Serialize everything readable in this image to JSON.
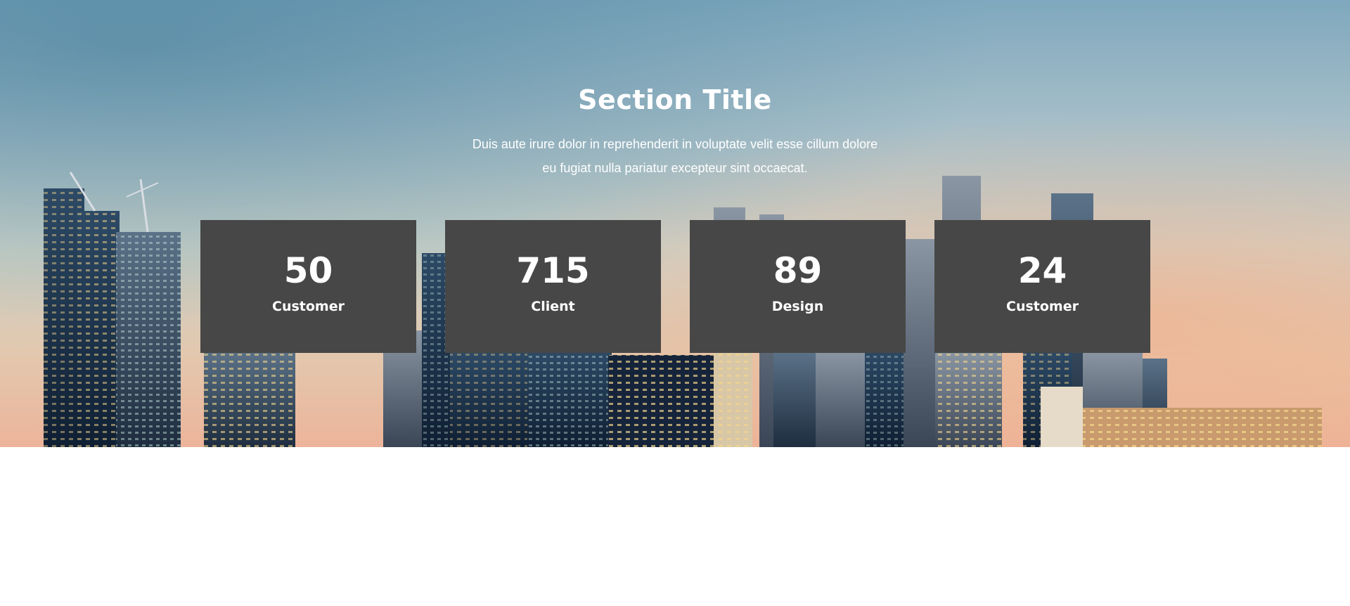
{
  "section": {
    "title": "Section Title",
    "description_line1": "Duis aute irure dolor in reprehenderit in voluptate velit esse cillum dolore",
    "description_line2": "eu fugiat nulla pariatur excepteur sint occaecat."
  },
  "stats": [
    {
      "value": "50",
      "label": "Customer"
    },
    {
      "value": "715",
      "label": "Client"
    },
    {
      "value": "89",
      "label": "Design"
    },
    {
      "value": "24",
      "label": "Customer"
    }
  ],
  "colors": {
    "card_background": "#474747",
    "text": "#ffffff",
    "page_background": "#ffffff"
  }
}
